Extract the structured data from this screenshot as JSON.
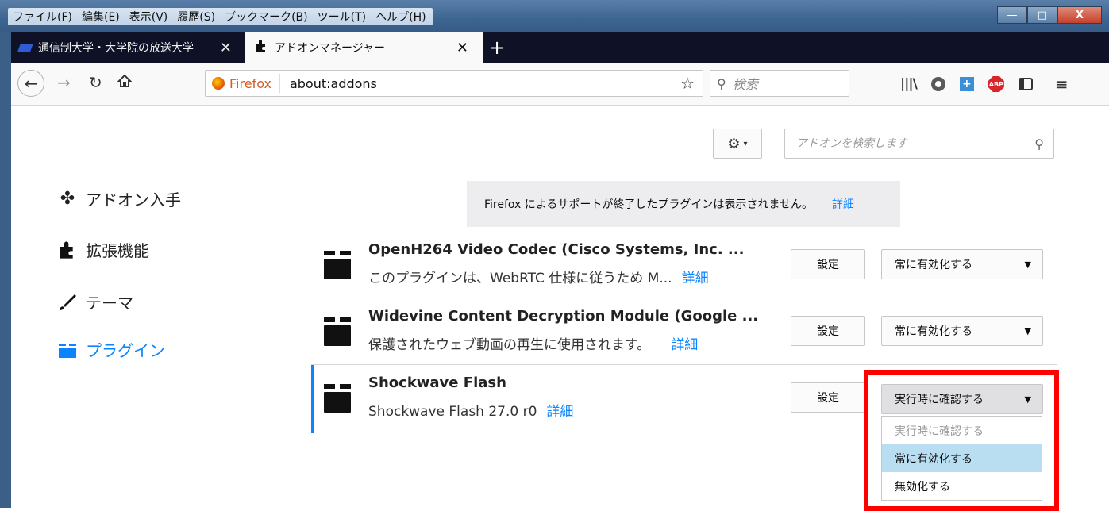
{
  "menubar": [
    "ファイル(F)",
    "編集(E)",
    "表示(V)",
    "履歴(S)",
    "ブックマーク(B)",
    "ツール(T)",
    "ヘルプ(H)"
  ],
  "window_controls": {
    "minimize": "—",
    "maximize": "□",
    "close": "X"
  },
  "tabs": [
    {
      "label": "通信制大学・大学院の放送大学",
      "close": "✕",
      "active": false
    },
    {
      "label": "アドオンマネージャー",
      "close": "✕",
      "active": true
    }
  ],
  "newtab": "+",
  "navbar": {
    "identity_label": "Firefox",
    "url": "about:addons",
    "search_placeholder": "検索"
  },
  "addons": {
    "search_placeholder": "アドオンを検索します",
    "categories": [
      {
        "label": "アドオン入手",
        "icon": "get-addons-icon",
        "selected": false
      },
      {
        "label": "拡張機能",
        "icon": "puzzle-icon",
        "selected": false
      },
      {
        "label": "テーマ",
        "icon": "brush-icon",
        "selected": false
      },
      {
        "label": "プラグイン",
        "icon": "plugin-icon",
        "selected": true
      }
    ],
    "notice": {
      "text": "Firefox によるサポートが終了したプラグインは表示されません。",
      "link": "詳細"
    },
    "plugins": [
      {
        "name": "OpenH264 Video Codec (Cisco Systems, Inc. ...",
        "desc": "このプラグインは、WebRTC 仕様に従うため M...",
        "link": "詳細",
        "settings": "設定",
        "state": "常に有効化する"
      },
      {
        "name": "Widevine Content Decryption Module (Google ...",
        "desc": "保護されたウェブ動画の再生に使用されます。",
        "link": "詳細",
        "settings": "設定",
        "state": "常に有効化する"
      },
      {
        "name": "Shockwave Flash",
        "desc": "Shockwave Flash 27.0 r0",
        "link": "詳細",
        "settings": "設定",
        "state": "実行時に確認する"
      }
    ],
    "dropdown_options": [
      "実行時に確認する",
      "常に有効化する",
      "無効化する"
    ]
  },
  "colors": {
    "accent": "#0a84ff",
    "highlight": "#ff0000",
    "option_hover": "#b9def2"
  }
}
